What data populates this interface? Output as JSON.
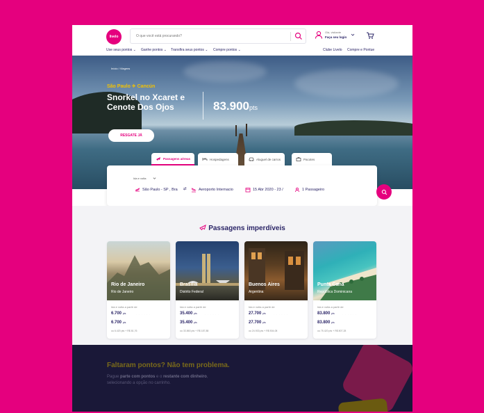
{
  "colors": {
    "brand": "#e5007e",
    "navy": "#2a2466",
    "gold": "#f4c200"
  },
  "header": {
    "logo": "livelo",
    "search_placeholder": "O que você está procurando?",
    "greeting": "Olá, visitante",
    "login": "Faça seu login",
    "nav_left": [
      "Use seus pontos",
      "Ganhe pontos",
      "Transfira seus pontos",
      "Compre pontos"
    ],
    "nav_right": [
      "Clube Livelo",
      "Compre e Pontue"
    ]
  },
  "hero": {
    "breadcrumb": [
      "Início",
      "Viagens"
    ],
    "route_from": "São Paulo",
    "route_to": "Cancún",
    "title": "Snorkel no Xcaret e Cenote Dos Ojos",
    "points": "83.900",
    "points_unit": "pts",
    "cta": "RESGATE JÁ"
  },
  "tabs": [
    {
      "label": "Passagens aéreas",
      "icon": "plane-icon",
      "active": true
    },
    {
      "label": "Hospedagens",
      "icon": "bed-icon",
      "active": false
    },
    {
      "label": "Aluguel de carros",
      "icon": "car-icon",
      "active": false
    },
    {
      "label": "Pacotes",
      "icon": "suitcase-icon",
      "active": false
    }
  ],
  "search": {
    "trip_type": "Ida e volta",
    "origin": "São Paulo - SP , Bra",
    "destination": "Aeroporto Internacio",
    "dates": "15 Abr 2020 - 23 /",
    "passengers": "1 Passageiro"
  },
  "deals": {
    "title": "Passagens imperdíveis",
    "from_label": "Ida e volta a partir de",
    "unit": "pts",
    "cards": [
      {
        "city": "Rio de Janeiro",
        "region": "Rio de Janeiro",
        "p1": "6.700",
        "p2": "6.700",
        "alt": "ou 6.420 pts + R$ 81,76"
      },
      {
        "city": "Brasília",
        "region": "Distrito Federal",
        "p1": "35.400",
        "p2": "35.400",
        "alt": "ou 33.860 pts + R$ 187,88"
      },
      {
        "city": "Buenos Aires",
        "region": "Argentina",
        "p1": "27.700",
        "p2": "27.700",
        "alt": "ou 24.933 pts + R$ 504,08"
      },
      {
        "city": "Punta Cana",
        "region": "República Dominicana",
        "p1": "83.800",
        "p2": "83.800",
        "alt": "ou 75.420 pts + R$ 807,28"
      }
    ]
  },
  "banner": {
    "title": "Faltaram pontos? Não tem problema.",
    "line1_a": "Pague ",
    "line1_b": "parte com pontos",
    "line1_c": " e o ",
    "line1_d": "restante com dinheiro",
    "line1_e": ",",
    "line2": "selecionando a opção no carrinho."
  }
}
